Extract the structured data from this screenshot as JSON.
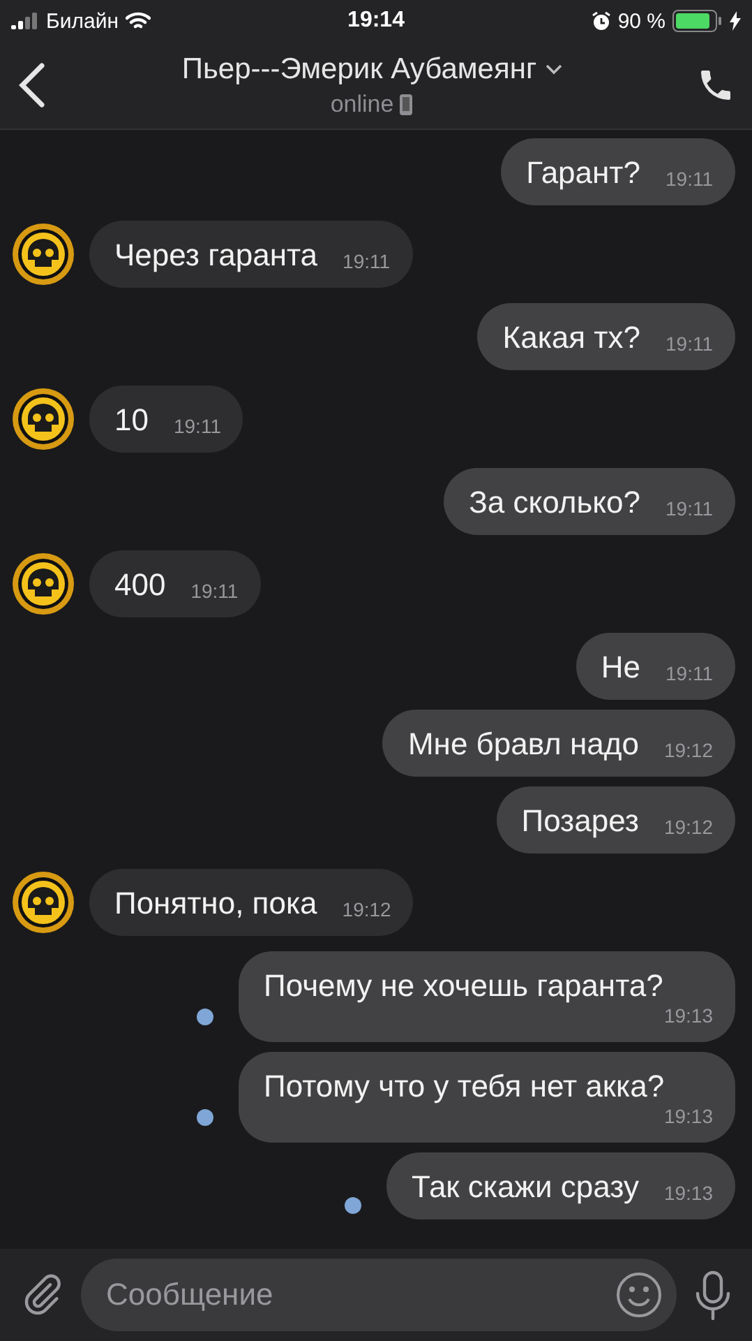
{
  "status_bar": {
    "carrier": "Билайн",
    "time": "19:14",
    "battery": "90 %"
  },
  "header": {
    "title": "Пьер---Эмерик Аубамеянг",
    "subtitle": "online"
  },
  "messages": [
    {
      "kind": "out",
      "text": "Гарант?",
      "time": "19:11",
      "unread": false
    },
    {
      "kind": "in",
      "text": "Через гаранта",
      "time": "19:11",
      "unread": false
    },
    {
      "kind": "out",
      "text": "Какая тх?",
      "time": "19:11",
      "unread": false
    },
    {
      "kind": "in",
      "text": "10",
      "time": "19:11",
      "unread": false
    },
    {
      "kind": "out",
      "text": "За сколько?",
      "time": "19:11",
      "unread": false
    },
    {
      "kind": "in",
      "text": "400",
      "time": "19:11",
      "unread": false
    },
    {
      "kind": "out",
      "text": "Не",
      "time": "19:11",
      "unread": false
    },
    {
      "kind": "out",
      "text": "Мне бравл надо",
      "time": "19:12",
      "unread": false
    },
    {
      "kind": "out",
      "text": "Позарез",
      "time": "19:12",
      "unread": false
    },
    {
      "kind": "in",
      "text": "Понятно, пока",
      "time": "19:12",
      "unread": false
    },
    {
      "kind": "out",
      "text": "Почему не хочешь гаранта?",
      "time": "19:13",
      "unread": true
    },
    {
      "kind": "out",
      "text": "Потому что у тебя нет акка?",
      "time": "19:13",
      "unread": true
    },
    {
      "kind": "out",
      "text": "Так скажи сразу",
      "time": "19:13",
      "unread": true
    }
  ],
  "composer": {
    "placeholder": "Сообщение"
  }
}
